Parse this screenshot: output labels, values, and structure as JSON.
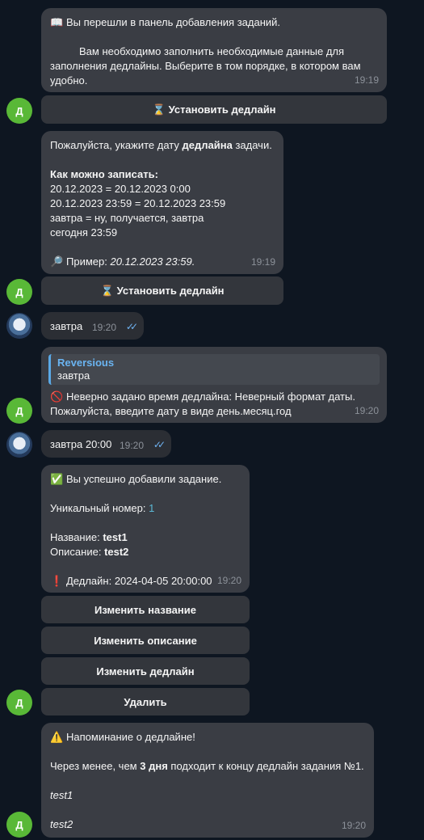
{
  "messages": {
    "m1": {
      "icon": "book-icon",
      "line1": "Вы перешли в панель добавления заданий.",
      "line2": "Вам необходимо заполнить необходимые данные для",
      "line3": "заполнения дедлайны. Выберите в том порядке, в котором вам",
      "line4": "удобно.",
      "time": "19:19",
      "button": "Установить дедлайн"
    },
    "m2": {
      "line1_pre": "Пожалуйста, укажите дату",
      "line1_bold": "дедлайна",
      "line1_post": "задачи.",
      "heading": "Как можно записать:",
      "ex1": "20.12.2023 = 20.12.2023 0:00",
      "ex2": "20.12.2023 23:59 = 20.12.2023 23:59",
      "ex3": "завтра = ну, получается, завтра",
      "ex4": "сегодня 23:59",
      "example_label": "Пример:",
      "example_value": "20.12.2023 23:59.",
      "time": "19:19",
      "button": "Установить дедлайн"
    },
    "u1": {
      "text": "завтра",
      "time": "19:20"
    },
    "m3": {
      "reply_name": "Reversious",
      "reply_text": "завтра",
      "line1": "Неверно задано время дедлайна: Неверный формат даты.",
      "line2": "Пожалуйста, введите дату в виде день.месяц.год",
      "time": "19:20"
    },
    "u2": {
      "text": "завтра 20:00",
      "time": "19:20"
    },
    "m4": {
      "line1": "Вы успешно добавили задание.",
      "id_label": "Уникальный номер:",
      "id_value": "1",
      "name_label": "Название:",
      "name_value": "test1",
      "desc_label": "Описание:",
      "desc_value": "test2",
      "deadline_label": "Дедлайн:",
      "deadline_value": "2024-04-05 20:00:00",
      "time": "19:20",
      "buttons": [
        "Изменить название",
        "Изменить описание",
        "Изменить дедлайн",
        "Удалить"
      ]
    },
    "m5": {
      "line1": "Напоминание о дедлайне!",
      "line2_pre": "Через менее, чем",
      "line2_bold": "3 дня",
      "line2_post": "подходит к концу дедлайн задания №1.",
      "name": "test1",
      "desc": "test2",
      "time": "19:20"
    }
  },
  "avatars": {
    "bot_letter": "Д"
  }
}
